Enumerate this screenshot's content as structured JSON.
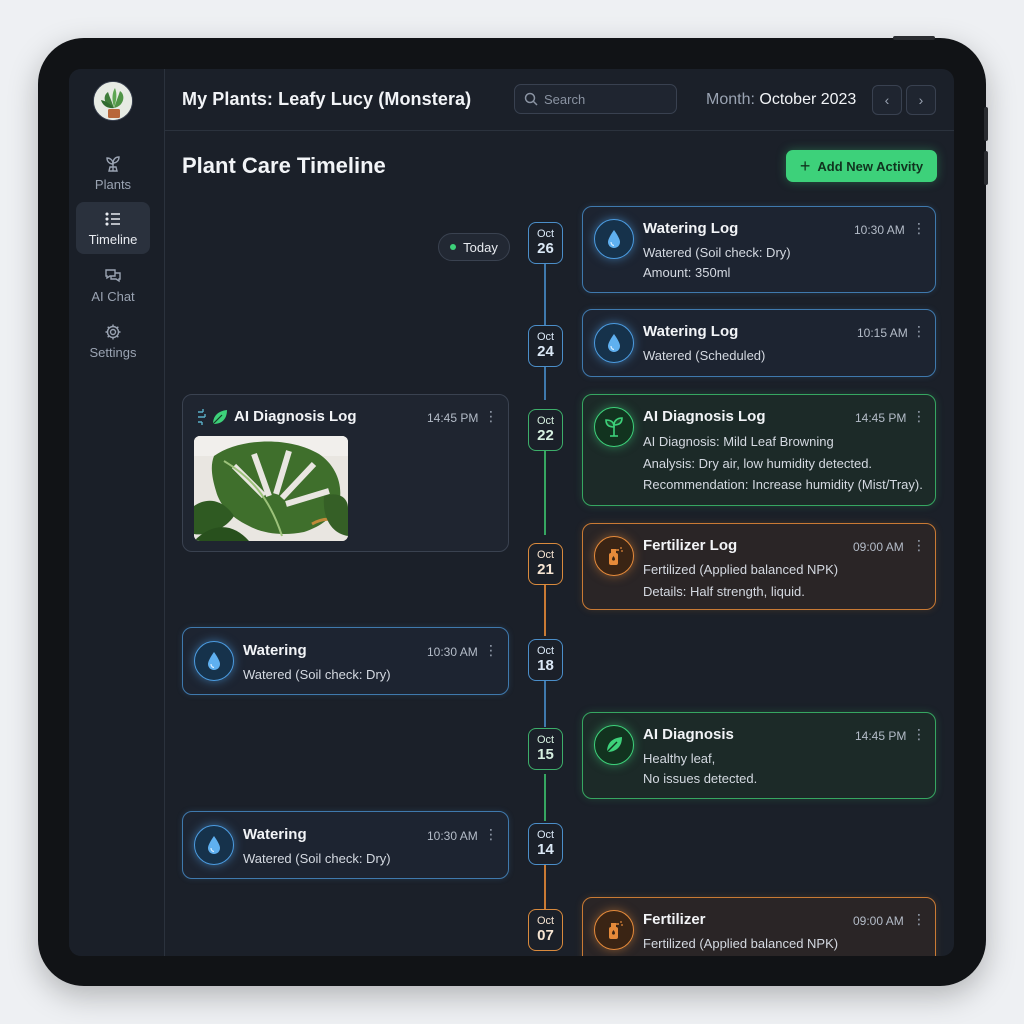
{
  "header": {
    "plant_title": "My Plants: Leafy Lucy (Monstera)",
    "search_placeholder": "Search",
    "month_label": "Month:",
    "month_value": "October 2023"
  },
  "sidebar": {
    "items": [
      {
        "label": "Plants",
        "icon": "sprout-icon"
      },
      {
        "label": "Timeline",
        "icon": "list-icon",
        "active": true
      },
      {
        "label": "AI Chat",
        "icon": "chat-icon"
      },
      {
        "label": "Settings",
        "icon": "gear-icon"
      }
    ]
  },
  "page_title": "Plant Care Timeline",
  "add_button_label": "Add New Activity",
  "today_label": "Today",
  "dates": [
    {
      "month": "Oct",
      "day": "26"
    },
    {
      "month": "Oct",
      "day": "24"
    },
    {
      "month": "Oct",
      "day": "22"
    },
    {
      "month": "Oct",
      "day": "21"
    },
    {
      "month": "Oct",
      "day": "18"
    },
    {
      "month": "Oct",
      "day": "15"
    },
    {
      "month": "Oct",
      "day": "14"
    },
    {
      "month": "Oct",
      "day": "07"
    }
  ],
  "cards": {
    "watering_26": {
      "title": "Watering Log",
      "time": "10:30 AM",
      "lines": [
        "Watered (Soil check: Dry)",
        "Amount: 350ml"
      ]
    },
    "watering_24": {
      "title": "Watering Log",
      "time": "10:15 AM",
      "lines": [
        "Watered (Scheduled)"
      ]
    },
    "diagnosis_22_left": {
      "title": "AI Diagnosis Log",
      "time": "14:45 PM"
    },
    "diagnosis_22": {
      "title": "AI Diagnosis Log",
      "time": "14:45 PM",
      "lines": [
        "AI Diagnosis: Mild Leaf Browning",
        "Analysis: Dry air, low humidity detected.",
        "Recommendation: Increase humidity (Mist/Tray)."
      ]
    },
    "fertilizer_21": {
      "title": "Fertilizer Log",
      "time": "09:00 AM",
      "lines": [
        "Fertilized (Applied balanced NPK)",
        "Details: Half strength, liquid."
      ]
    },
    "watering_18": {
      "title": "Watering",
      "time": "10:30 AM",
      "lines": [
        "Watered (Soil check: Dry)"
      ]
    },
    "diagnosis_15": {
      "title": "AI Diagnosis",
      "time": "14:45 PM",
      "lines": [
        "Healthy leaf,",
        "No issues detected."
      ]
    },
    "watering_14": {
      "title": "Watering",
      "time": "10:30 AM",
      "lines": [
        "Watered (Soil check: Dry)"
      ]
    },
    "fertilizer_07": {
      "title": "Fertilizer",
      "time": "09:00 AM",
      "lines": [
        "Fertilized (Applied balanced NPK)"
      ]
    }
  },
  "colors": {
    "water": "#4b9be0",
    "diagnosis": "#3dd17a",
    "fertilizer": "#e58a3a",
    "accent_button": "#3dd17a"
  }
}
